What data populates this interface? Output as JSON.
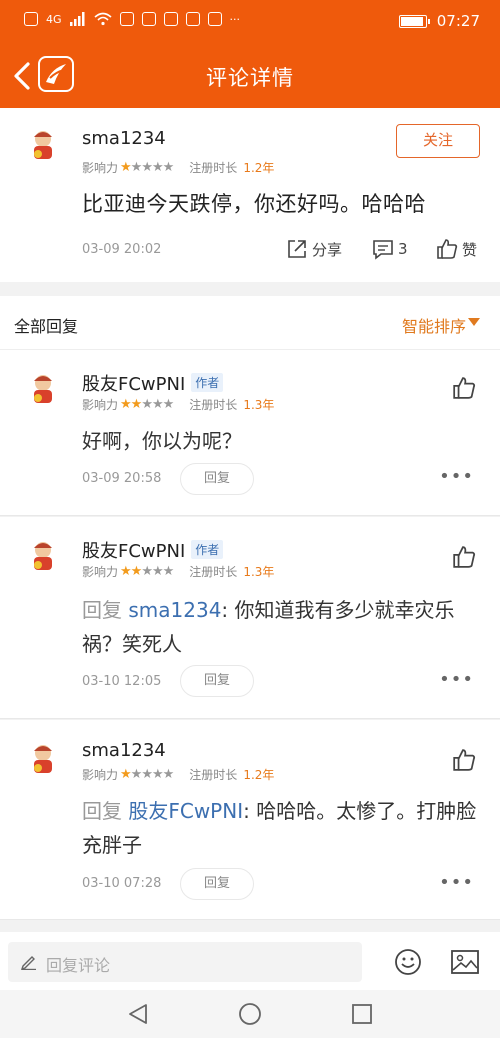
{
  "status_bar": {
    "time": "07:27",
    "network_label": "4G"
  },
  "nav": {
    "title": "评论详情"
  },
  "main_comment": {
    "username": "sma1234",
    "influence_label": "影响力",
    "influence_stars": 1,
    "register_label": "注册时长",
    "register_years": "1.2年",
    "follow_label": "关注",
    "content": "比亚迪今天跌停，你还好吗。哈哈哈",
    "time": "03-09 20:02",
    "share_label": "分享",
    "comment_count": "3",
    "like_label": "赞"
  },
  "section": {
    "title": "全部回复",
    "sort_label": "智能排序"
  },
  "replies": [
    {
      "username": "股友FCwPNI",
      "badge": "作者",
      "influence_label": "影响力",
      "influence_stars": 2,
      "register_label": "注册时长",
      "register_years": "1.3年",
      "content": "好啊，你以为呢？",
      "time": "03-09 20:58",
      "reply_label": "回复"
    },
    {
      "username": "股友FCwPNI",
      "badge": "作者",
      "influence_label": "影响力",
      "influence_stars": 2,
      "register_label": "注册时长",
      "register_years": "1.3年",
      "reply_prefix": "回复",
      "reply_target": "sma1234",
      "content": ": 你知道我有多少就幸灾乐祸？笑死人",
      "time": "03-10 12:05",
      "reply_label": "回复"
    },
    {
      "username": "sma1234",
      "influence_label": "影响力",
      "influence_stars": 1,
      "register_label": "注册时长",
      "register_years": "1.2年",
      "reply_prefix": "回复",
      "reply_target": "股友FCwPNI",
      "content": ": 哈哈哈。太惨了。打肿脸充胖子",
      "time": "03-10 07:28",
      "reply_label": "回复"
    }
  ],
  "input_bar": {
    "placeholder": "回复评论"
  },
  "colors": {
    "brand": "#ef5a0c",
    "accent": "#e4662a",
    "link": "#3c6fb0",
    "star": "#f29b1d"
  },
  "icons": [
    "back-icon",
    "app-logo-icon",
    "share-icon",
    "comment-icon",
    "like-icon",
    "more-icon",
    "pencil-icon",
    "emoji-icon",
    "image-icon",
    "back-triangle-icon",
    "home-circle-icon",
    "recent-square-icon"
  ]
}
